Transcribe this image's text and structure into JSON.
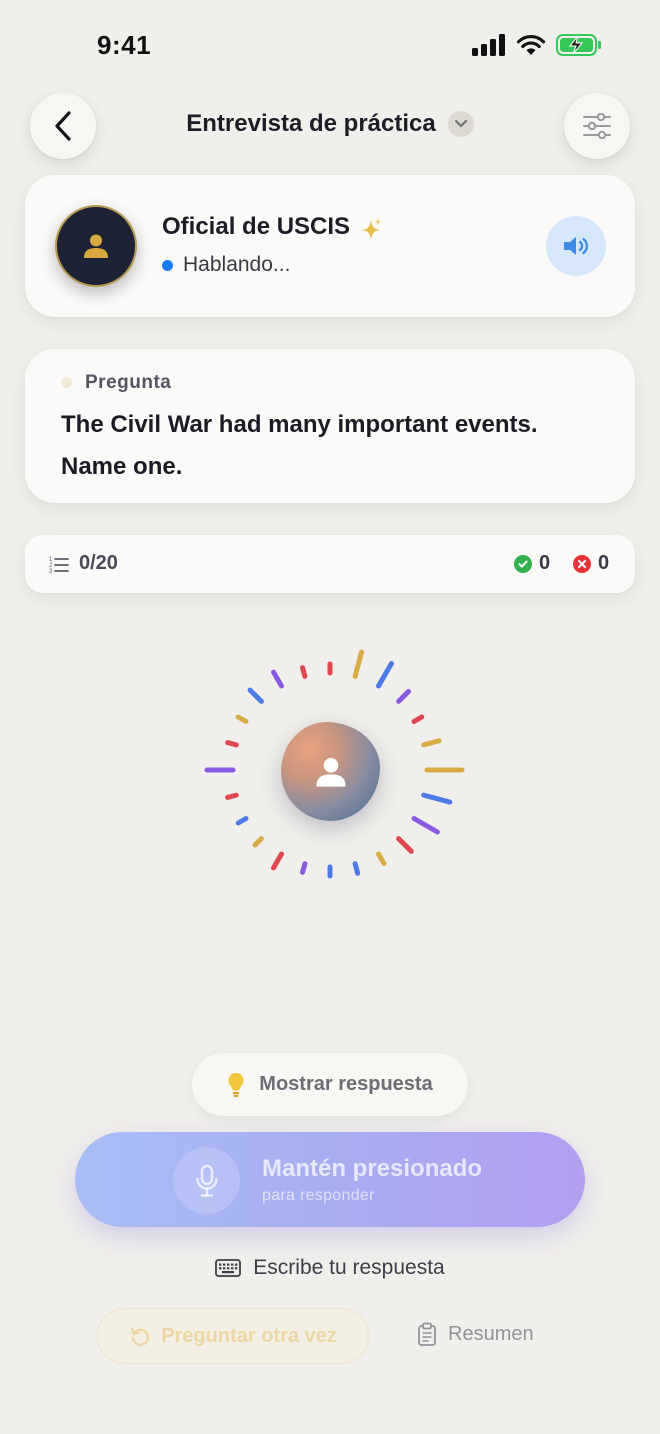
{
  "status_bar": {
    "time": "9:41"
  },
  "header": {
    "title": "Entrevista de práctica"
  },
  "officer": {
    "name": "Oficial de USCIS",
    "status": "Hablando..."
  },
  "question": {
    "label": "Pregunta",
    "text": "The Civil War had many important events. Name one."
  },
  "progress": {
    "count": "0/20",
    "correct": "0",
    "wrong": "0"
  },
  "actions": {
    "show_answer": "Mostrar respuesta",
    "hold_title": "Mantén presionado",
    "hold_subtitle": "para responder",
    "type_answer": "Escribe tu respuesta",
    "ask_again": "Preguntar otra vez",
    "summary": "Resumen"
  },
  "colors": {
    "accent_blue": "#1a7cf5",
    "correct_green": "#35b04e",
    "wrong_red": "#e3343a",
    "gold": "#d7ac45"
  }
}
